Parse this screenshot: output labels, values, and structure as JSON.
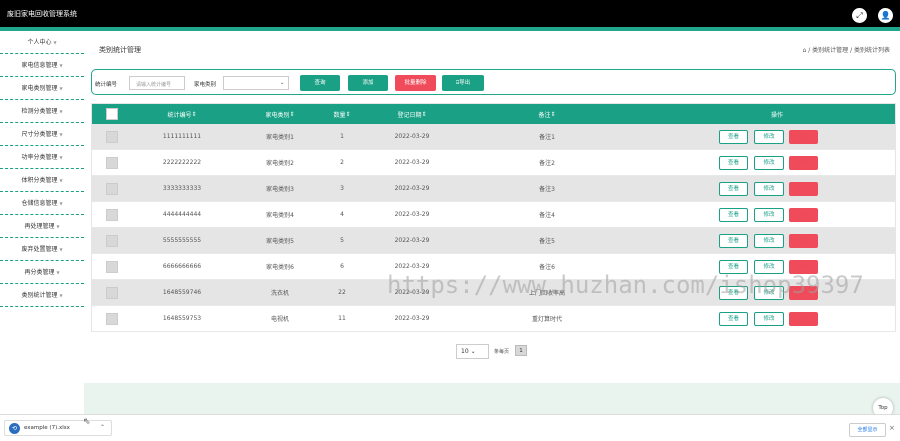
{
  "app": {
    "title": "废旧家电回收管理系统"
  },
  "topbar_icons": [
    "expand-icon",
    "user-icon"
  ],
  "sidebar": {
    "items": [
      {
        "label": "个人中心"
      },
      {
        "label": "家电信息管理"
      },
      {
        "label": "家电类别管理"
      },
      {
        "label": "检测分类管理"
      },
      {
        "label": "尺寸分类管理"
      },
      {
        "label": "功率分类管理"
      },
      {
        "label": "体积分类管理"
      },
      {
        "label": "仓储信息管理"
      },
      {
        "label": "再处理管理"
      },
      {
        "label": "废弃处置管理"
      },
      {
        "label": "再分类管理"
      },
      {
        "label": "类别统计管理"
      }
    ]
  },
  "main": {
    "page_title": "类别统计管理",
    "breadcrumb": {
      "home_icon": "home-icon",
      "text": "/ 类别统计管理 / 类别统计列表"
    }
  },
  "search": {
    "code_label": "统计编号",
    "code_placeholder": "请输入统计编号",
    "type_label": "家电类别",
    "type_value": "",
    "query_label": "查询",
    "add_label": "添加",
    "batch_delete_label": "批量删除",
    "export_label": "导出",
    "export_icon": "export-icon"
  },
  "table": {
    "headers": [
      "统计编号",
      "家电类别",
      "数量",
      "登记日期",
      "备注",
      "操作"
    ],
    "actions": {
      "view": "查看",
      "edit": "修改",
      "delete": "删除"
    },
    "rows": [
      {
        "code": "1111111111",
        "type": "家电类别1",
        "qty": "1",
        "date": "2022-03-29",
        "note": "备注1"
      },
      {
        "code": "2222222222",
        "type": "家电类别2",
        "qty": "2",
        "date": "2022-03-29",
        "note": "备注2"
      },
      {
        "code": "3333333333",
        "type": "家电类别3",
        "qty": "3",
        "date": "2022-03-29",
        "note": "备注3"
      },
      {
        "code": "4444444444",
        "type": "家电类别4",
        "qty": "4",
        "date": "2022-03-29",
        "note": "备注4"
      },
      {
        "code": "5555555555",
        "type": "家电类别5",
        "qty": "5",
        "date": "2022-03-29",
        "note": "备注5"
      },
      {
        "code": "6666666666",
        "type": "家电类别6",
        "qty": "6",
        "date": "2022-03-29",
        "note": "备注6"
      },
      {
        "code": "1648559746",
        "type": "洗衣机",
        "qty": "22",
        "date": "2022-03-29",
        "note": "上门回收率高"
      },
      {
        "code": "1648559753",
        "type": "电视机",
        "qty": "11",
        "date": "2022-03-29",
        "note": "重灯算时代"
      }
    ]
  },
  "pagination": {
    "page_size": "10",
    "total_label": "条每页",
    "current_page": "1"
  },
  "top_button": {
    "label": "Top"
  },
  "download_bar": {
    "file_name": "example (7).xlsx",
    "show_all_label": "全部显示",
    "close_label": "×"
  },
  "watermark": {
    "text": "https://www.huzhan.com/ishop39397"
  },
  "colors": {
    "accent": "#1aa085",
    "danger": "#f04b5a",
    "topbar": "#000000"
  }
}
